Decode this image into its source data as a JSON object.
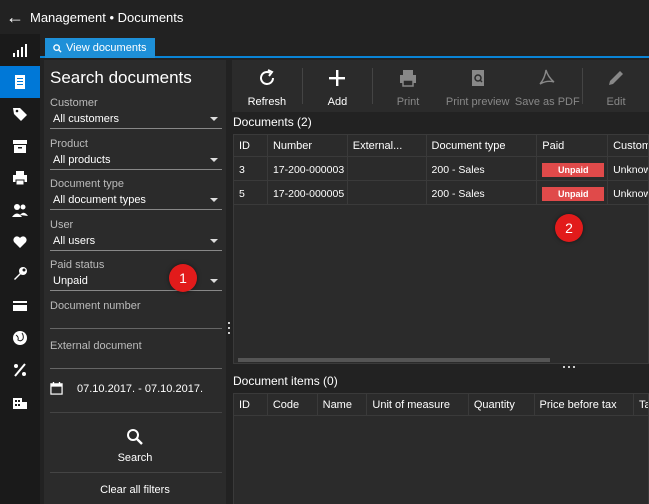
{
  "window": {
    "title": "Management • Documents"
  },
  "tabs": [
    {
      "label": "View documents"
    }
  ],
  "search": {
    "title": "Search documents",
    "customer": {
      "label": "Customer",
      "value": "All customers"
    },
    "product": {
      "label": "Product",
      "value": "All products"
    },
    "document_type": {
      "label": "Document type",
      "value": "All document types"
    },
    "user": {
      "label": "User",
      "value": "All users"
    },
    "paid_status": {
      "label": "Paid status",
      "value": "Unpaid"
    },
    "document_number": {
      "label": "Document number",
      "value": ""
    },
    "external_document": {
      "label": "External document",
      "value": ""
    },
    "date_range": "07.10.2017. - 07.10.2017.",
    "search_label": "Search",
    "clear_label": "Clear all filters"
  },
  "toolbar": {
    "refresh": "Refresh",
    "add": "Add",
    "print": "Print",
    "print_preview": "Print preview",
    "save_pdf": "Save as PDF",
    "edit": "Edit"
  },
  "documents": {
    "title": "Documents (2)",
    "columns": [
      "ID",
      "Number",
      "External...",
      "Document type",
      "Paid",
      "Custom"
    ],
    "rows": [
      {
        "id": "3",
        "number": "17-200-000003",
        "external": "",
        "type": "200 - Sales",
        "paid": "Unpaid",
        "customer": "Unknow"
      },
      {
        "id": "5",
        "number": "17-200-000005",
        "external": "",
        "type": "200 - Sales",
        "paid": "Unpaid",
        "customer": "Unknow"
      }
    ]
  },
  "items": {
    "title": "Document items (0)",
    "columns": [
      "ID",
      "Code",
      "Name",
      "Unit of measure",
      "Quantity",
      "Price before tax",
      "Ta"
    ]
  },
  "markers": [
    "1",
    "2"
  ],
  "colors": {
    "accent": "#0a84d6",
    "unpaid": "#e04a4a",
    "marker": "#e21b1b"
  }
}
